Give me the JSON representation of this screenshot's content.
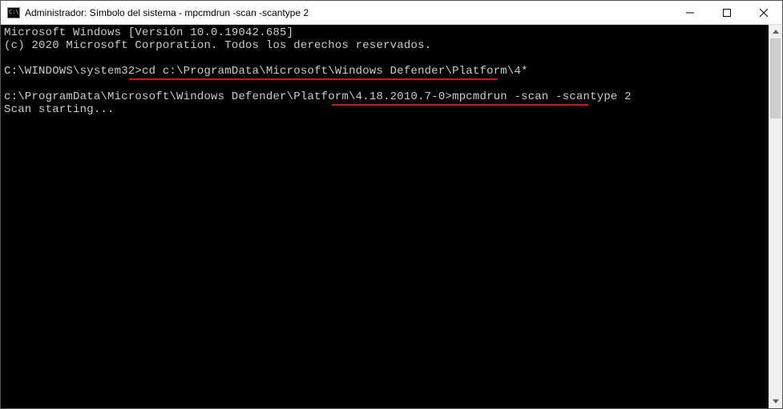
{
  "titlebar": {
    "title": "Administrador: Símbolo del sistema - mpcmdrun  -scan -scantype 2"
  },
  "terminal": {
    "line1": "Microsoft Windows [Versión 10.0.19042.685]",
    "line2": "(c) 2020 Microsoft Corporation. Todos los derechos reservados.",
    "blank1": "",
    "prompt1": "C:\\WINDOWS\\system32>",
    "cmd1": "cd c:\\ProgramData\\Microsoft\\Windows Defender\\Platform\\4*",
    "blank2": "",
    "prompt2_a": "c:\\ProgramData\\Microsoft\\Windows Defender\\Platform\\",
    "prompt2_b": "4.18.2010.7-0>",
    "cmd2": "mpcmdrun -scan -scantype 2",
    "line_out": "Scan starting..."
  }
}
